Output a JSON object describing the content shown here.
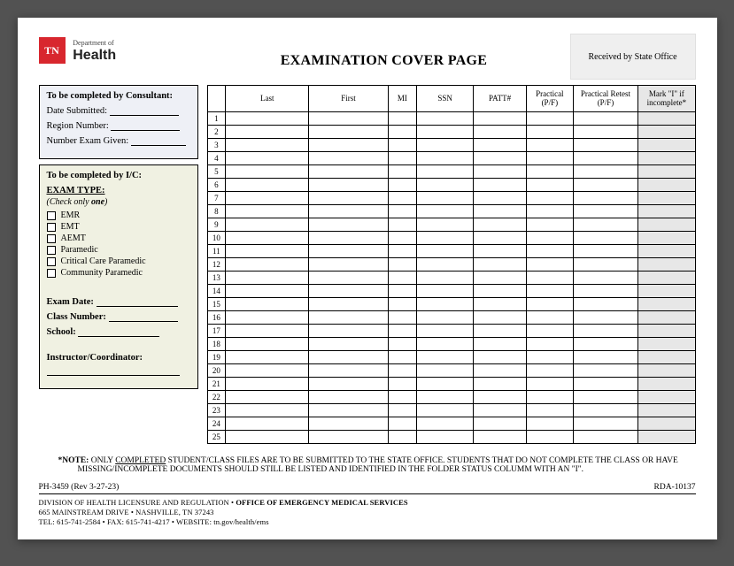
{
  "logo": {
    "badge": "TN",
    "line1": "Department of",
    "line2": "Health"
  },
  "title": "EXAMINATION COVER PAGE",
  "stamp": "Received by State Office",
  "consultant": {
    "heading": "To be completed by Consultant:",
    "date_label": "Date Submitted:",
    "region_label": "Region Number:",
    "exam_given_label": "Number Exam Given:"
  },
  "ic": {
    "heading": "To be completed by I/C:",
    "exam_type_label": "EXAM TYPE:",
    "check_instr": "(Check only one)",
    "options": [
      "EMR",
      "EMT",
      "AEMT",
      "Paramedic",
      "Critical Care Paramedic",
      "Community Paramedic"
    ],
    "exam_date_label": "Exam Date:",
    "class_number_label": "Class Number:",
    "school_label": "School:",
    "instructor_label": "Instructor/Coordinator:"
  },
  "table": {
    "headers": {
      "last": "Last",
      "first": "First",
      "mi": "MI",
      "ssn": "SSN",
      "patt": "PATT#",
      "practical": "Practical\n(P/F)",
      "retest": "Practical Retest\n(P/F)",
      "mark": "Mark \"I\" if incomplete*"
    },
    "row_count": 25
  },
  "note": {
    "label": "*NOTE:",
    "text_pre": "ONLY ",
    "text_underline": "COMPLETED",
    "text_post": " STUDENT/CLASS FILES ARE TO BE SUBMITTED TO THE STATE OFFICE. STUDENTS THAT DO NOT COMPLETE THE CLASS OR HAVE MISSING/INCOMPLETE DOCUMENTS SHOULD STILL BE LISTED AND IDENTIFIED IN THE FOLDER STATUS COLUMM WITH AN \"I\"."
  },
  "footer": {
    "form_no": "PH-3459 (Rev 3-27-23)",
    "rda": "RDA-10137",
    "division": "DIVISION OF HEALTH LICENSURE AND REGULATION • ",
    "office": "OFFICE OF EMERGENCY MEDICAL SERVICES",
    "address": "665 MAINSTREAM DRIVE • NASHVILLE, TN 37243",
    "contact": "TEL: 615-741-2584 • FAX: 615-741-4217 • WEBSITE: tn.gov/health/ems"
  }
}
